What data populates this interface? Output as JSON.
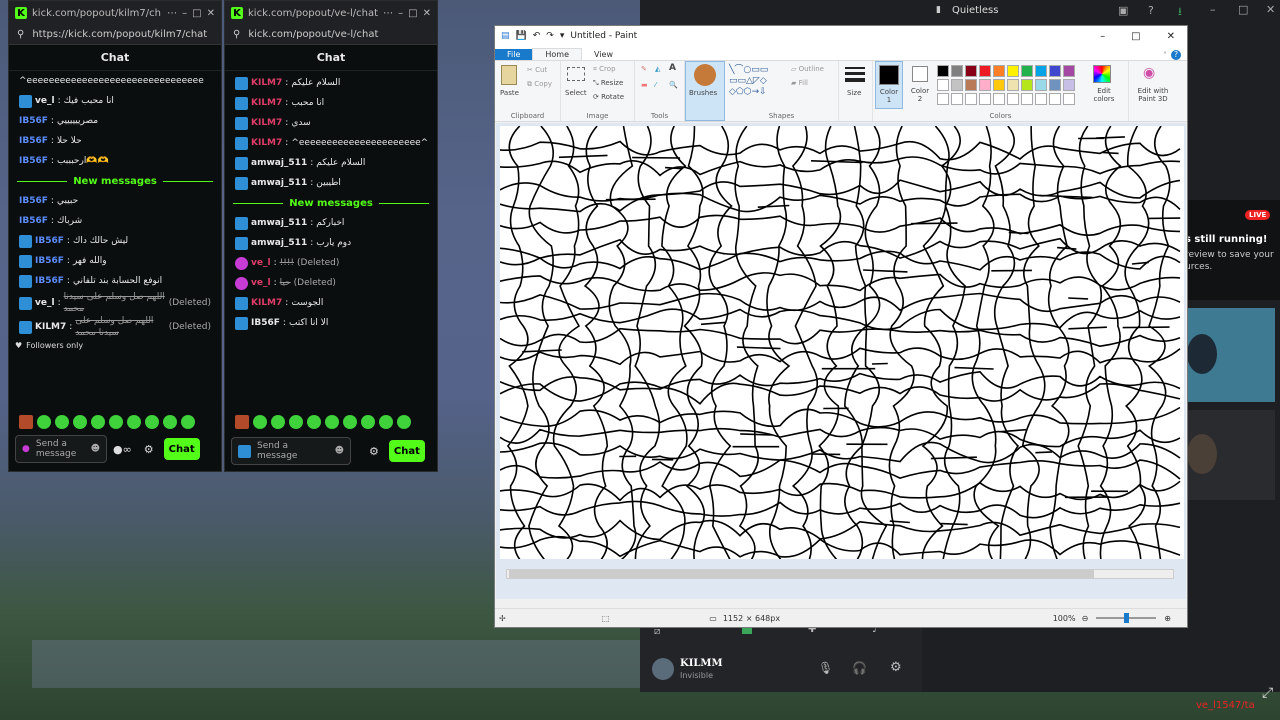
{
  "kick1": {
    "title": "kick.com/popout/kilm7/ch...",
    "url": "https://kick.com/popout/kilm7/chat",
    "header": "Chat",
    "messages_before": [
      {
        "user": "",
        "text": "^ееееееееееееееееееееееееееееееее",
        "badge": false,
        "color": "#e8e8e8"
      },
      {
        "user": "ve_l",
        "text": "انا محبب فيك",
        "badge": true,
        "color": "#e8e8e8"
      },
      {
        "user": "IB56F",
        "text": "مصرييييييي",
        "badge": false,
        "color": "#5b8dff"
      },
      {
        "user": "IB56F",
        "text": "حلا حلا",
        "badge": false,
        "color": "#5b8dff"
      },
      {
        "user": "IB56F",
        "text": "ارحبببب🫶🫶",
        "badge": false,
        "color": "#5b8dff"
      }
    ],
    "new_messages_label": "New messages",
    "messages_after": [
      {
        "user": "IB56F",
        "text": "حبيبي",
        "badge": false,
        "color": "#5b8dff",
        "del": false
      },
      {
        "user": "IB56F",
        "text": "شرباك",
        "badge": false,
        "color": "#5b8dff",
        "del": false
      },
      {
        "user": "IB56F",
        "text": "ليش حالك داك",
        "badge": true,
        "color": "#5b8dff",
        "del": false
      },
      {
        "user": "IB56F",
        "text": "والله فهر",
        "badge": true,
        "color": "#5b8dff",
        "del": false
      },
      {
        "user": "IB56F",
        "text": "انوفع الحسابة بند تلفاني",
        "badge": true,
        "color": "#5b8dff",
        "del": false
      },
      {
        "user": "ve_l",
        "text": "اللهم صل وسلم على سيدنا محمد",
        "badge": true,
        "color": "#e8e8e8",
        "del": true
      },
      {
        "user": "KILM7",
        "text": "اللهم صل وسلم على سيدنا محمد",
        "badge": true,
        "color": "#e8e8e8",
        "del": true
      }
    ],
    "deleted_label": "(Deleted)",
    "followers_only": "Followers only",
    "input_placeholder": "Send a message",
    "chat_button": "Chat"
  },
  "kick2": {
    "title": "kick.com/popout/ve-l/chat...",
    "url": "kick.com/popout/ve-l/chat",
    "header": "Chat",
    "messages_before": [
      {
        "user": "KILM7",
        "text": "السلام عليكم",
        "color": "#e03c6a",
        "del": false
      },
      {
        "user": "KILM7",
        "text": "انا محبب",
        "color": "#e03c6a",
        "del": false
      },
      {
        "user": "KILM7",
        "text": "سدي",
        "color": "#e03c6a",
        "del": false
      },
      {
        "user": "KILM7",
        "text": "^ееееееееееееееееееееее^",
        "color": "#e03c6a",
        "del": false
      },
      {
        "user": "amwaj_511",
        "text": "السلام عليكم",
        "color": "#e8e8e8",
        "del": false
      },
      {
        "user": "amwaj_511",
        "text": "اطيبين",
        "color": "#e8e8e8",
        "del": false
      }
    ],
    "new_messages_label": "New messages",
    "messages_after": [
      {
        "user": "amwaj_511",
        "text": "اخباركم",
        "color": "#e8e8e8",
        "del": false
      },
      {
        "user": "amwaj_511",
        "text": "دوم يارب",
        "color": "#e8e8e8",
        "del": false
      },
      {
        "user": "ve_l",
        "text": "!!!!",
        "color": "#e03c6a",
        "del": true
      },
      {
        "user": "ve_l",
        "text": "حيا",
        "color": "#e03c6a",
        "del": true
      },
      {
        "user": "KILM7",
        "text": "الجوست",
        "color": "#e03c6a",
        "del": false
      },
      {
        "user": "IB56F",
        "text": "الا انا اكتب",
        "color": "#e8e8e8",
        "del": false
      }
    ],
    "deleted_label": "(Deleted)",
    "input_placeholder": "Send a message",
    "chat_button": "Chat"
  },
  "paint": {
    "title": "Untitled - Paint",
    "tabs": [
      "File",
      "Home",
      "View"
    ],
    "clipboard": {
      "paste": "Paste",
      "cut": "Cut",
      "copy": "Copy",
      "label": "Clipboard"
    },
    "image": {
      "select": "Select",
      "crop": "Crop",
      "resize": "Resize",
      "rotate": "Rotate",
      "label": "Image"
    },
    "tools_label": "Tools",
    "brushes": "Brushes",
    "shapes": {
      "outline": "Outline",
      "fill": "Fill",
      "label": "Shapes"
    },
    "size": "Size",
    "color1": "Color 1",
    "color2": "Color 2",
    "colors_label": "Colors",
    "edit_colors": "Edit colors",
    "edit_paint3d": "Edit with Paint 3D",
    "palette": [
      "#000000",
      "#7f7f7f",
      "#880015",
      "#ed1c24",
      "#ff7f27",
      "#fff200",
      "#22b14c",
      "#00a2e8",
      "#3f48cc",
      "#a349a4",
      "#ffffff",
      "#c3c3c3",
      "#b97a57",
      "#ffaec9",
      "#ffc90e",
      "#efe4b0",
      "#b5e61d",
      "#99d9ea",
      "#7092be",
      "#c8bfe7"
    ],
    "dimensions": "1152 × 648px",
    "zoom": "100%"
  },
  "bg": {
    "app_title": "Quietless",
    "live": "LIVE",
    "panel_text1": "s still running!",
    "panel_text2": "review to save your",
    "panel_text3": "urces.",
    "username": "KILMM",
    "status": "Invisible",
    "corner_text": "ve_l1547/ta"
  }
}
